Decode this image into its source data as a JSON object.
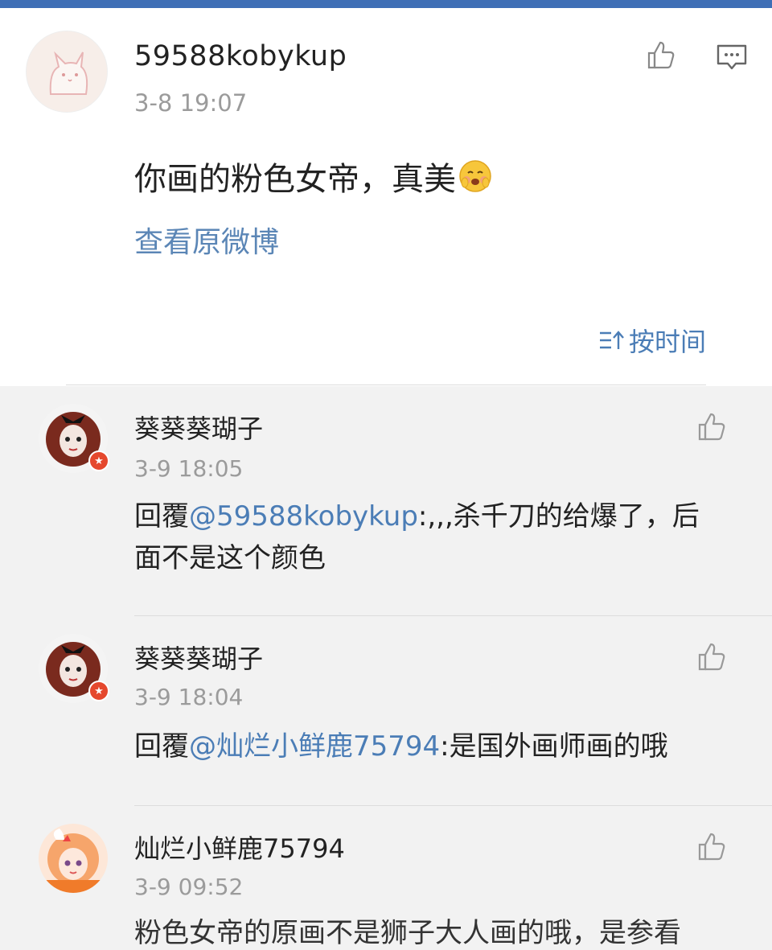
{
  "main_comment": {
    "username": "59588kobykup",
    "time": "3-8 19:07",
    "content": "你画的粉色女帝，真美",
    "view_original": "查看原微博"
  },
  "sort": {
    "label": "按时间"
  },
  "replies": [
    {
      "username": "葵葵葵瑚子",
      "time": "3-9 18:05",
      "prefix": "回覆",
      "mention": "@59588kobykup",
      "text": ":,,,杀千刀的给爆了，后面不是这个颜色"
    },
    {
      "username": "葵葵葵瑚子",
      "time": "3-9 18:04",
      "prefix": "回覆",
      "mention": "@灿烂小鲜鹿75794",
      "text": ":是国外画师画的哦"
    },
    {
      "username": "灿烂小鲜鹿75794",
      "time": "3-9 09:52",
      "text": "粉色女帝的原画不是狮子大人画的哦，是参看"
    }
  ],
  "icons": {
    "like": "thumbs-up-icon",
    "reply": "comment-icon",
    "sort": "sort-icon",
    "verified": "verified-badge-icon"
  },
  "colors": {
    "accent": "#4b7db6",
    "top_bar": "#3f6fb6",
    "badge": "#e5482d"
  }
}
